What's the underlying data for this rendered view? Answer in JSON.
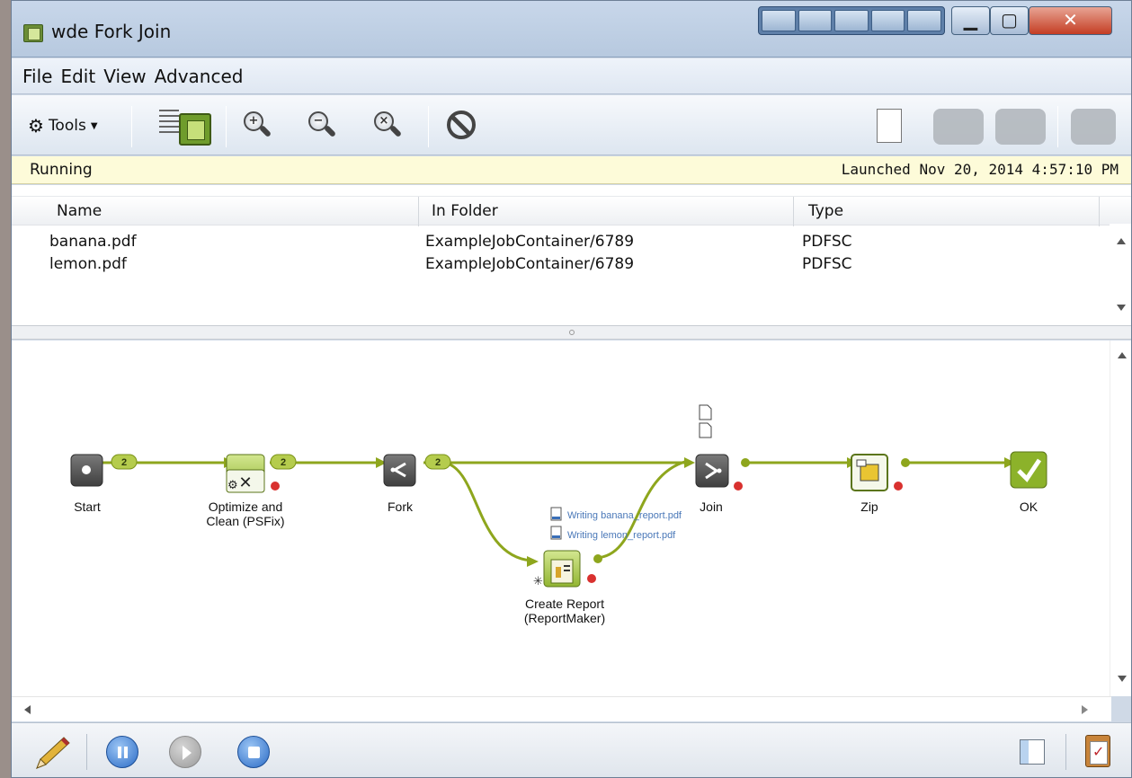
{
  "window": {
    "title": "wde Fork Join"
  },
  "menu": {
    "items": [
      "File",
      "Edit",
      "View",
      "Advanced"
    ]
  },
  "toolbar": {
    "tools_label": "Tools",
    "icons": [
      "gear-icon",
      "report-list-icon",
      "zoom-in-icon",
      "zoom-out-icon",
      "zoom-reset-icon",
      "stop-sign-icon",
      "new-document-icon",
      "tag-heart-icon",
      "tag-badge-icon",
      "tag-icon"
    ]
  },
  "status": {
    "state": "Running",
    "launched": "Launched Nov 20, 2014 4:57:10 PM",
    "background_color": "#fdfbd9"
  },
  "jobs_table": {
    "columns": [
      "Name",
      "In Folder",
      "Type"
    ],
    "rows": [
      {
        "name": "banana.pdf",
        "folder": "ExampleJobContainer/6789",
        "type": "PDFSC"
      },
      {
        "name": "lemon.pdf",
        "folder": "ExampleJobContainer/6789",
        "type": "PDFSC"
      }
    ]
  },
  "flow": {
    "connection_color": "#8ea61d",
    "elements": {
      "start": {
        "label": "Start"
      },
      "optimize": {
        "label_line1": "Optimize and",
        "label_line2": "Clean (PSFix)"
      },
      "fork": {
        "label": "Fork"
      },
      "report": {
        "label_line1": "Create Report",
        "label_line2": "(ReportMaker)"
      },
      "join": {
        "label": "Join"
      },
      "zip": {
        "label": "Zip"
      },
      "ok": {
        "label": "OK"
      }
    },
    "badges": {
      "start_out": "2",
      "optimize_out": "2",
      "fork_out": "2"
    },
    "writing": [
      "Writing banana_report.pdf",
      "Writing lemon_report.pdf"
    ]
  },
  "bottom": {
    "icons": [
      "pencil-icon",
      "pause-icon",
      "play-icon",
      "stop-icon",
      "panel-icon",
      "clipboard-check-icon"
    ]
  }
}
